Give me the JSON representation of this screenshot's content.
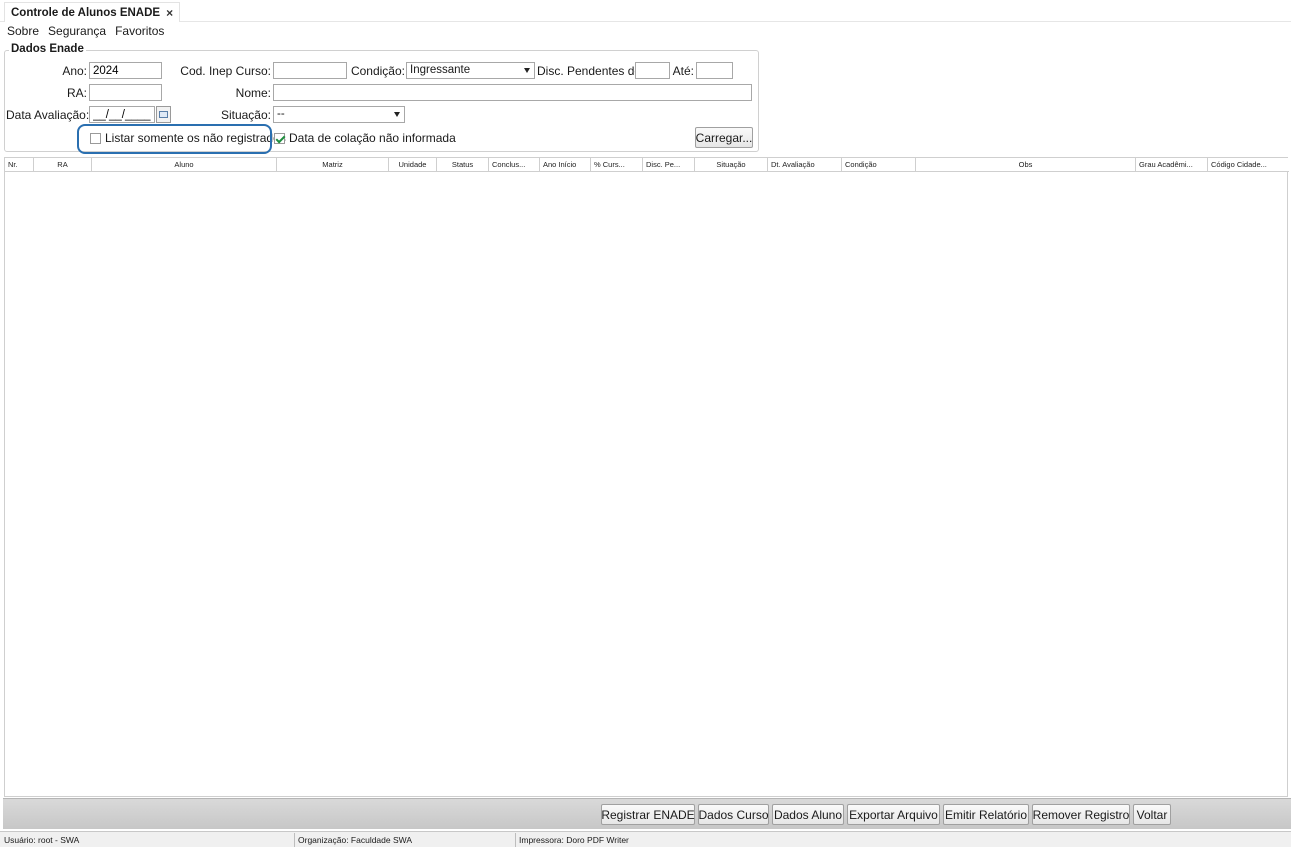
{
  "tab": {
    "title": "Controle de Alunos ENADE",
    "close": "×"
  },
  "menu": [
    "Sobre",
    "Segurança",
    "Favoritos"
  ],
  "group_title": "Dados Enade",
  "form": {
    "ano_label": "Ano:",
    "ano_value": "2024",
    "cod_inep_label": "Cod. Inep Curso:",
    "cod_inep_value": "",
    "condicao_label": "Condição:",
    "condicao_value": "Ingressante",
    "disc_pend_label": "Disc. Pendentes de:",
    "disc_pend_value": "",
    "ate_label": "Até:",
    "ate_value": "",
    "ra_label": "RA:",
    "ra_value": "",
    "nome_label": "Nome:",
    "nome_value": "",
    "data_aval_label": "Data Avaliação:",
    "data_aval_value": "__/__/____",
    "situacao_label": "Situação:",
    "situacao_value": "--",
    "listar_label": "Listar somente os não registrados",
    "listar_checked": false,
    "colacao_label": "Data de colação não informada",
    "colacao_checked": true,
    "carregar_label": "Carregar..."
  },
  "table": {
    "columns": [
      "Nr.",
      "RA",
      "Aluno",
      "Matriz",
      "Unidade",
      "Status",
      "Conclus...",
      "Ano Início",
      "% Curs...",
      "Disc. Pe...",
      "Situação",
      "Dt. Avaliação",
      "Condição",
      "Obs",
      "Grau Acadêmi...",
      "Código Cidade..."
    ],
    "rows": []
  },
  "actions": [
    "Registrar ENADE",
    "Dados Curso",
    "Dados Aluno",
    "Exportar Arquivo",
    "Emitir Relatório",
    "Remover Registro",
    "Voltar"
  ],
  "status": {
    "usuario": "Usuário: root - SWA",
    "organizacao": "Organização: Faculdade SWA",
    "impressora": "Impressora: Doro PDF Writer"
  }
}
